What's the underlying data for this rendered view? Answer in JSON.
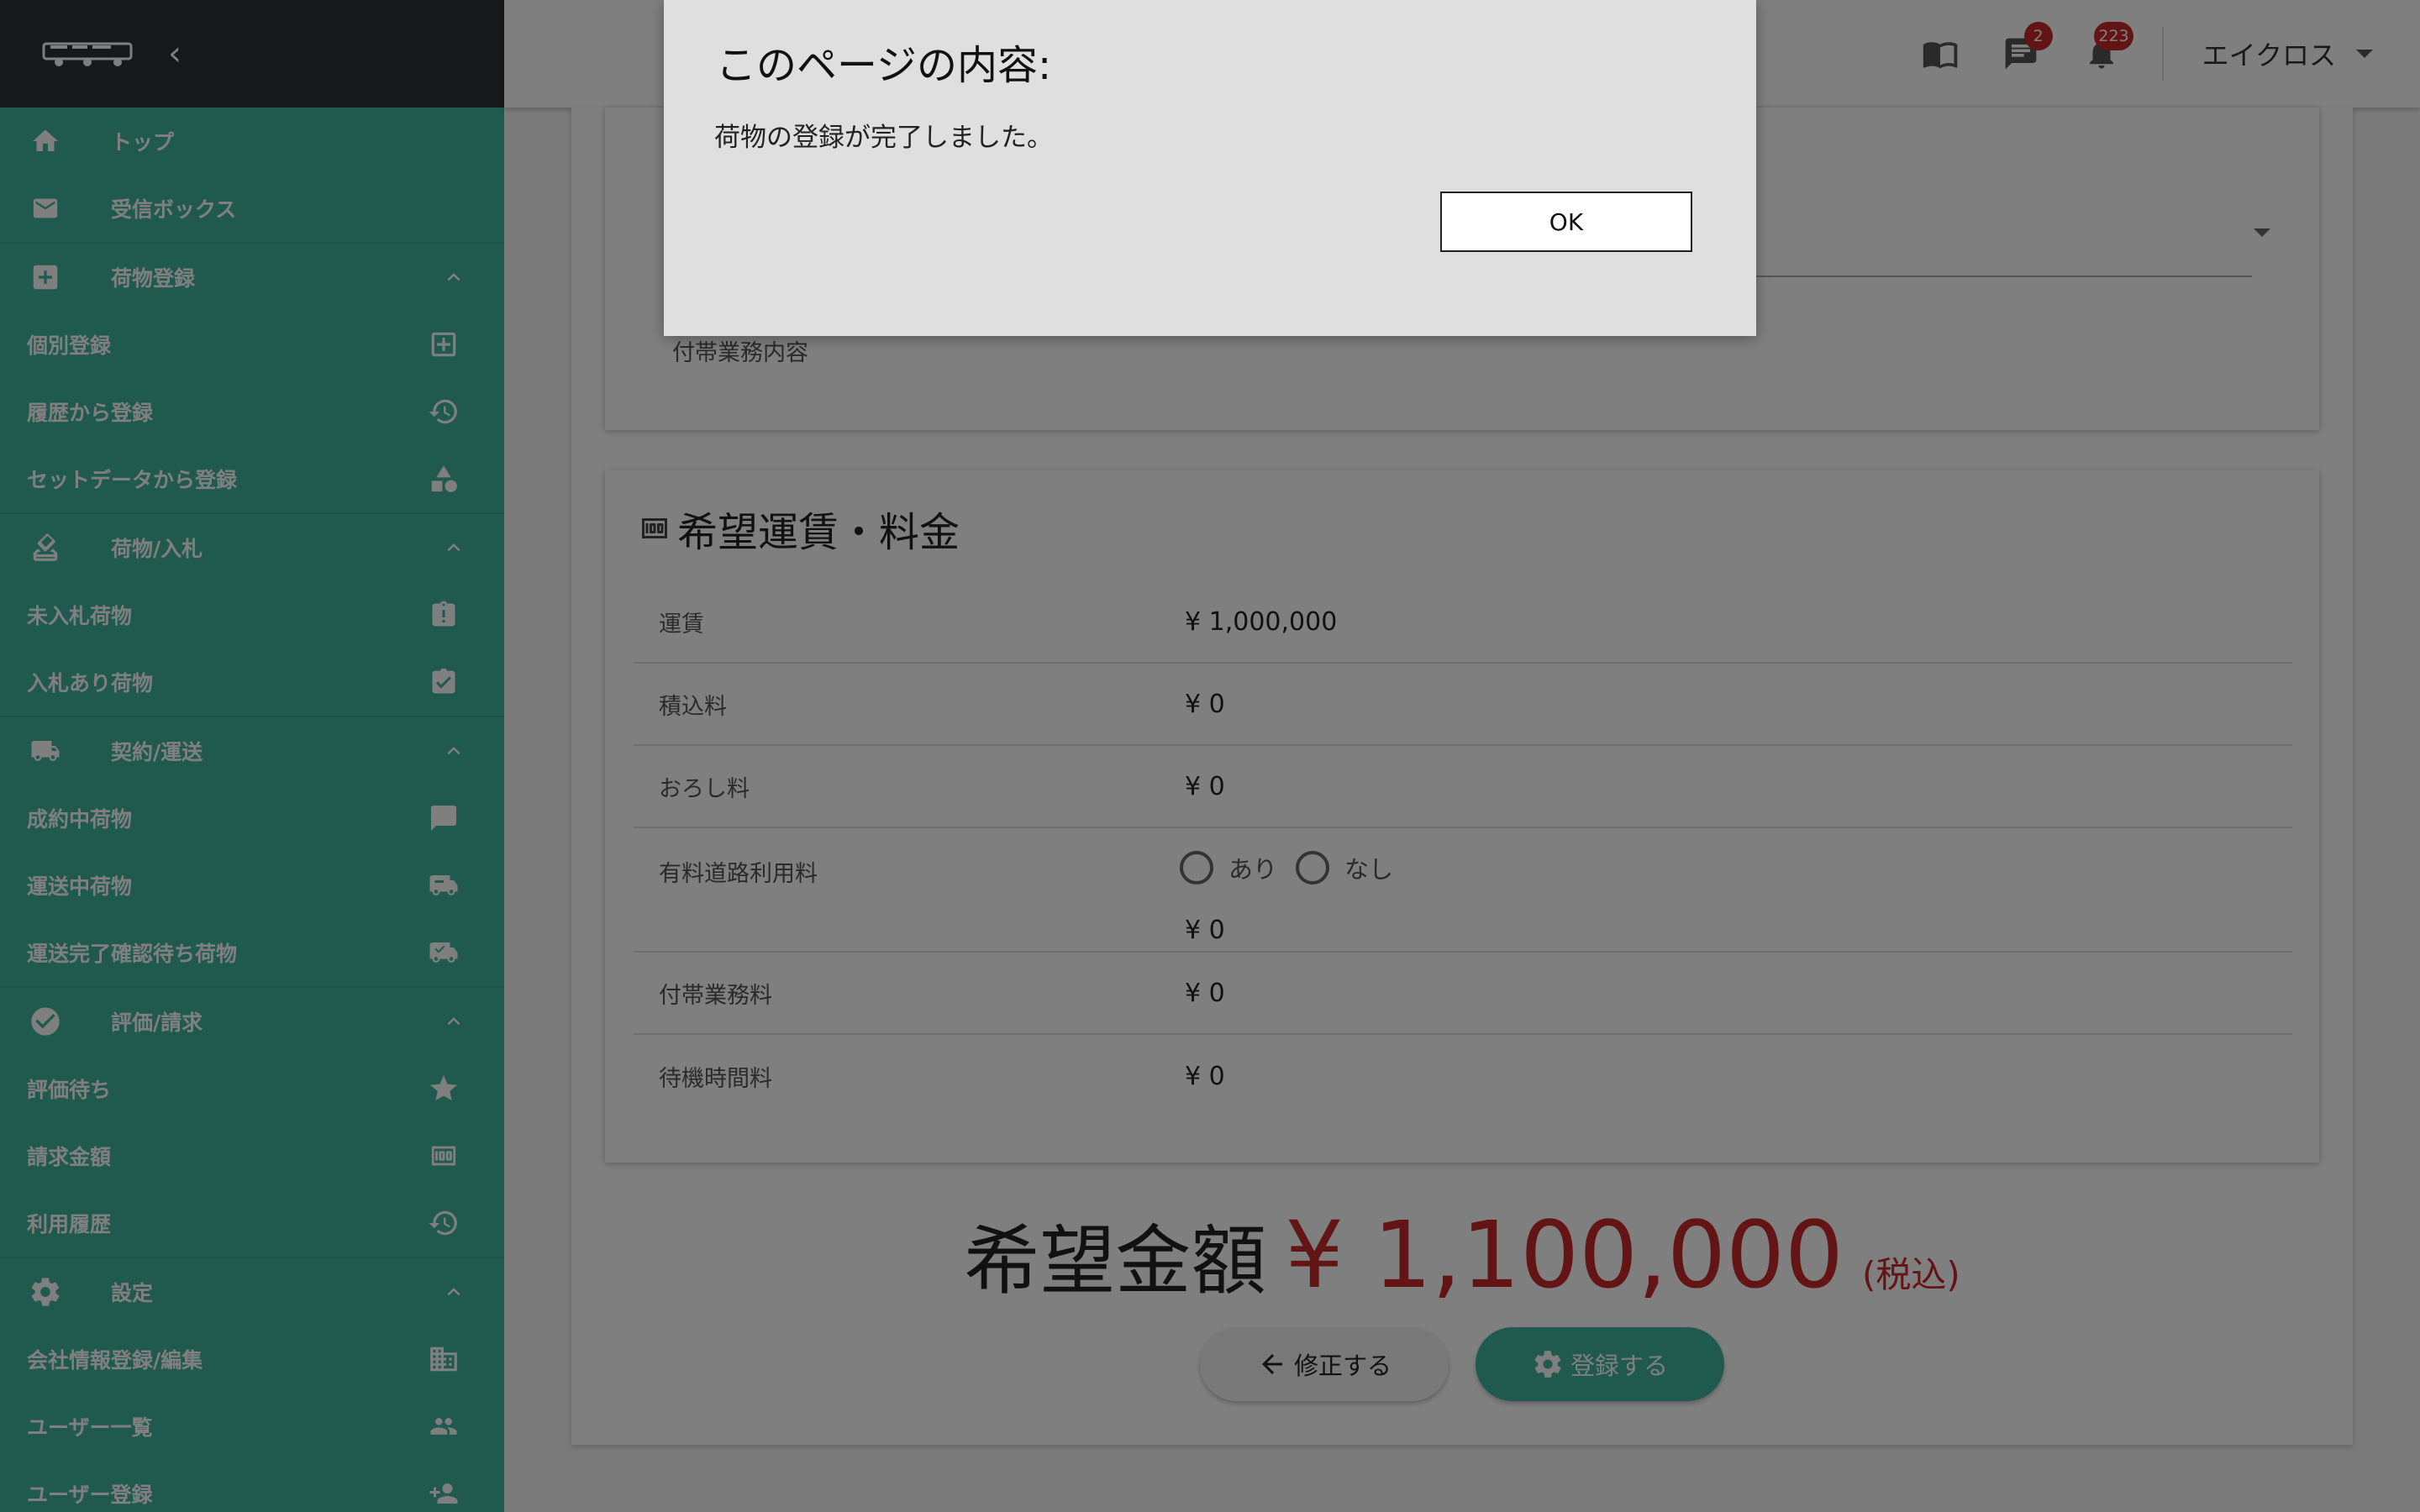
{
  "sidebar": {
    "items": [
      {
        "label": "トップ"
      },
      {
        "label": "受信ボックス"
      },
      {
        "label": "荷物登録"
      },
      {
        "label": "個別登録"
      },
      {
        "label": "履歴から登録"
      },
      {
        "label": "セットデータから登録"
      },
      {
        "label": "荷物/入札"
      },
      {
        "label": "未入札荷物"
      },
      {
        "label": "入札あり荷物"
      },
      {
        "label": "契約/運送"
      },
      {
        "label": "成約中荷物"
      },
      {
        "label": "運送中荷物"
      },
      {
        "label": "運送完了確認待ち荷物"
      },
      {
        "label": "評価/請求"
      },
      {
        "label": "評価待ち"
      },
      {
        "label": "請求金額"
      },
      {
        "label": "利用履歴"
      },
      {
        "label": "設定"
      },
      {
        "label": "会社情報登録/編集"
      },
      {
        "label": "ユーザー一覧"
      },
      {
        "label": "ユーザー登録"
      }
    ]
  },
  "header": {
    "message_badge": "2",
    "notification_badge": "223",
    "user_name": "エイクロス"
  },
  "top_section": {
    "extra_work_label": "付帯業務内容"
  },
  "fare": {
    "title": "希望運賃・料金",
    "rows": [
      {
        "label": "運賃",
        "value": "¥ 1,000,000"
      },
      {
        "label": "積込料",
        "value": "¥ 0"
      },
      {
        "label": "おろし料",
        "value": "¥ 0"
      },
      {
        "label": "有料道路利用料",
        "value": "¥ 0",
        "options": [
          "あり",
          "なし"
        ]
      },
      {
        "label": "付帯業務料",
        "value": "¥ 0"
      },
      {
        "label": "待機時間料",
        "value": "¥ 0"
      }
    ]
  },
  "total": {
    "label": "希望金額",
    "amount": "¥ 1,100,000",
    "note": "(税込)"
  },
  "actions": {
    "back_label": "修正する",
    "submit_label": "登録する"
  },
  "dialog": {
    "title": "このページの内容:",
    "message": "荷物の登録が完了しました。",
    "ok_label": "OK"
  },
  "colors": {
    "sidebar": "#41b59c",
    "sidebar_header": "#2c3337",
    "accent_red": "#c62828"
  }
}
